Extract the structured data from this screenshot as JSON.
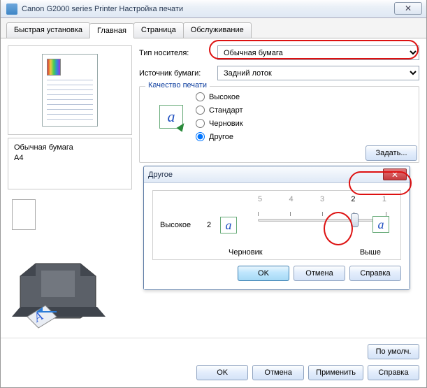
{
  "window": {
    "title": "Canon G2000 series Printer Настройка печати",
    "close_glyph": "✕"
  },
  "tabs": [
    {
      "label": "Быстрая установка",
      "active": false
    },
    {
      "label": "Главная",
      "active": true
    },
    {
      "label": "Страница",
      "active": false
    },
    {
      "label": "Обслуживание",
      "active": false
    }
  ],
  "left": {
    "media_line1": "Обычная бумага",
    "media_line2": "A4"
  },
  "form": {
    "media_label": "Тип носителя:",
    "media_value": "Обычная бумага",
    "source_label": "Источник бумаги:",
    "source_value": "Задний лоток"
  },
  "quality": {
    "legend": "Качество печати",
    "options": [
      "Высокое",
      "Стандарт",
      "Черновик",
      "Другое"
    ],
    "selected": "Другое",
    "set_btn": "Задать..."
  },
  "inner": {
    "title": "Другое",
    "close_glyph": "✕",
    "scale_labels": [
      "5",
      "4",
      "3",
      "2",
      "1"
    ],
    "left_label": "Высокое",
    "num_left": "2",
    "below_left": "Черновик",
    "below_right": "Выше",
    "ok": "OK",
    "cancel": "Отмена",
    "help": "Справка",
    "thumb_pos_pct": 75
  },
  "footer": {
    "defaults": "По умолч.",
    "ok": "OK",
    "cancel": "Отмена",
    "apply": "Применить",
    "help": "Справка"
  }
}
